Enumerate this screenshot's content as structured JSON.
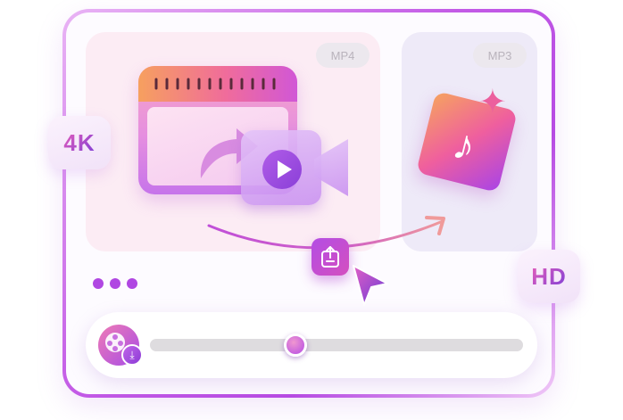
{
  "formats": {
    "video_badge": "MP4",
    "audio_badge": "MP3"
  },
  "resolutions": {
    "left": "4K",
    "right": "HD"
  },
  "icons": {
    "clapperboard": "video-clapper-icon",
    "camera": "video-camera-icon",
    "music": "music-note-icon",
    "sparkle": "sparkle-icon",
    "export": "export-icon",
    "cursor": "cursor-icon",
    "download": "video-download-icon"
  },
  "progress": {
    "value": 0.39
  },
  "colors": {
    "accent": "#b047e2",
    "accent_pink": "#e85fb9",
    "track": "#dedcdf"
  }
}
